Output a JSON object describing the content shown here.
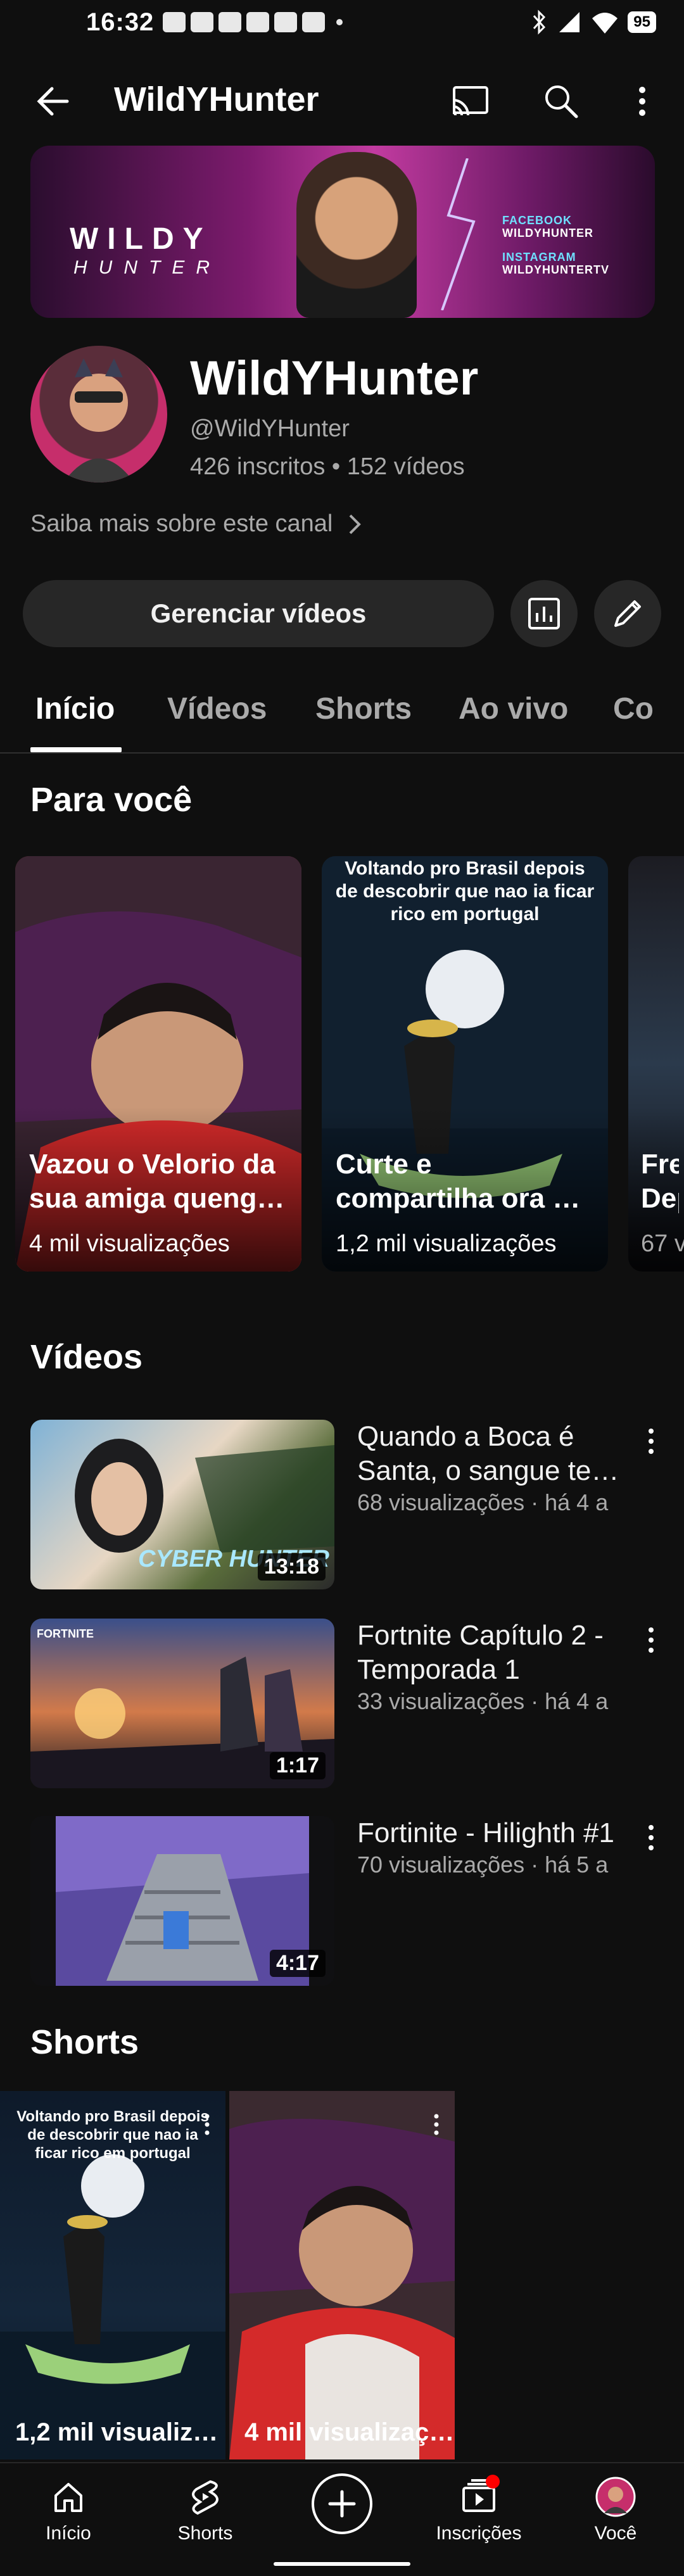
{
  "status_bar": {
    "time": "16:32",
    "battery": "95"
  },
  "header": {
    "title": "WildYHunter"
  },
  "banner": {
    "brand_line1": "WILDY",
    "brand_line2": "HUNTER",
    "facebook_label": "FACEBOOK",
    "facebook_handle": "WILDYHUNTER",
    "instagram_label": "INSTAGRAM",
    "instagram_handle": "WILDYHUNTERTV"
  },
  "channel": {
    "name": "WildYHunter",
    "handle": "@WildYHunter",
    "stats": "426 inscritos • 152 vídeos",
    "more_about": "Saiba mais sobre este canal"
  },
  "actions": {
    "manage_label": "Gerenciar vídeos"
  },
  "tabs": [
    {
      "label": "Início"
    },
    {
      "label": "Vídeos"
    },
    {
      "label": "Shorts"
    },
    {
      "label": "Ao vivo"
    },
    {
      "label": "Co"
    }
  ],
  "for_you": {
    "title": "Para você",
    "cards": [
      {
        "title": "Vazou o Velorio da sua amiga queng…",
        "views": "4 mil visualizações",
        "caption": ""
      },
      {
        "title": "Curte e compartilha ora …",
        "views": "1,2 mil visualizações",
        "caption": "Voltando pro Brasil depois de descobrir que nao ia ficar rico em portugal"
      },
      {
        "title": "Fre Dep",
        "views": "67 v",
        "caption": ""
      }
    ]
  },
  "videos": {
    "title": "Vídeos",
    "items": [
      {
        "title": "Quando a Boca é Santa, o sangue te…",
        "meta": "68 visualizações · há 4 a",
        "duration": "13:18",
        "thumb_text": "CYBER HUNTER"
      },
      {
        "title": "Fortnite Capítulo 2 - Temporada 1",
        "meta": "33 visualizações · há 4 a",
        "duration": "1:17",
        "thumb_text": "FORTNITE"
      },
      {
        "title": "Fortinite - Hilighth #1",
        "meta": "70 visualizações · há 5 a",
        "duration": "4:17",
        "thumb_text": ""
      }
    ]
  },
  "shorts": {
    "title": "Shorts",
    "items": [
      {
        "views": "1,2 mil visualiz…",
        "caption": "Voltando pro Brasil depois de descobrir que nao ia ficar rico em portugal"
      },
      {
        "views": "4 mil visualizaç…",
        "caption": ""
      }
    ]
  },
  "bottom_nav": {
    "home": "Início",
    "shorts": "Shorts",
    "subscriptions": "Inscrições",
    "you": "Você"
  },
  "colors": {
    "background": "#0f0f0f",
    "surface": "#272727",
    "secondary_text": "#aaaaaa",
    "notification": "#ff0000"
  }
}
